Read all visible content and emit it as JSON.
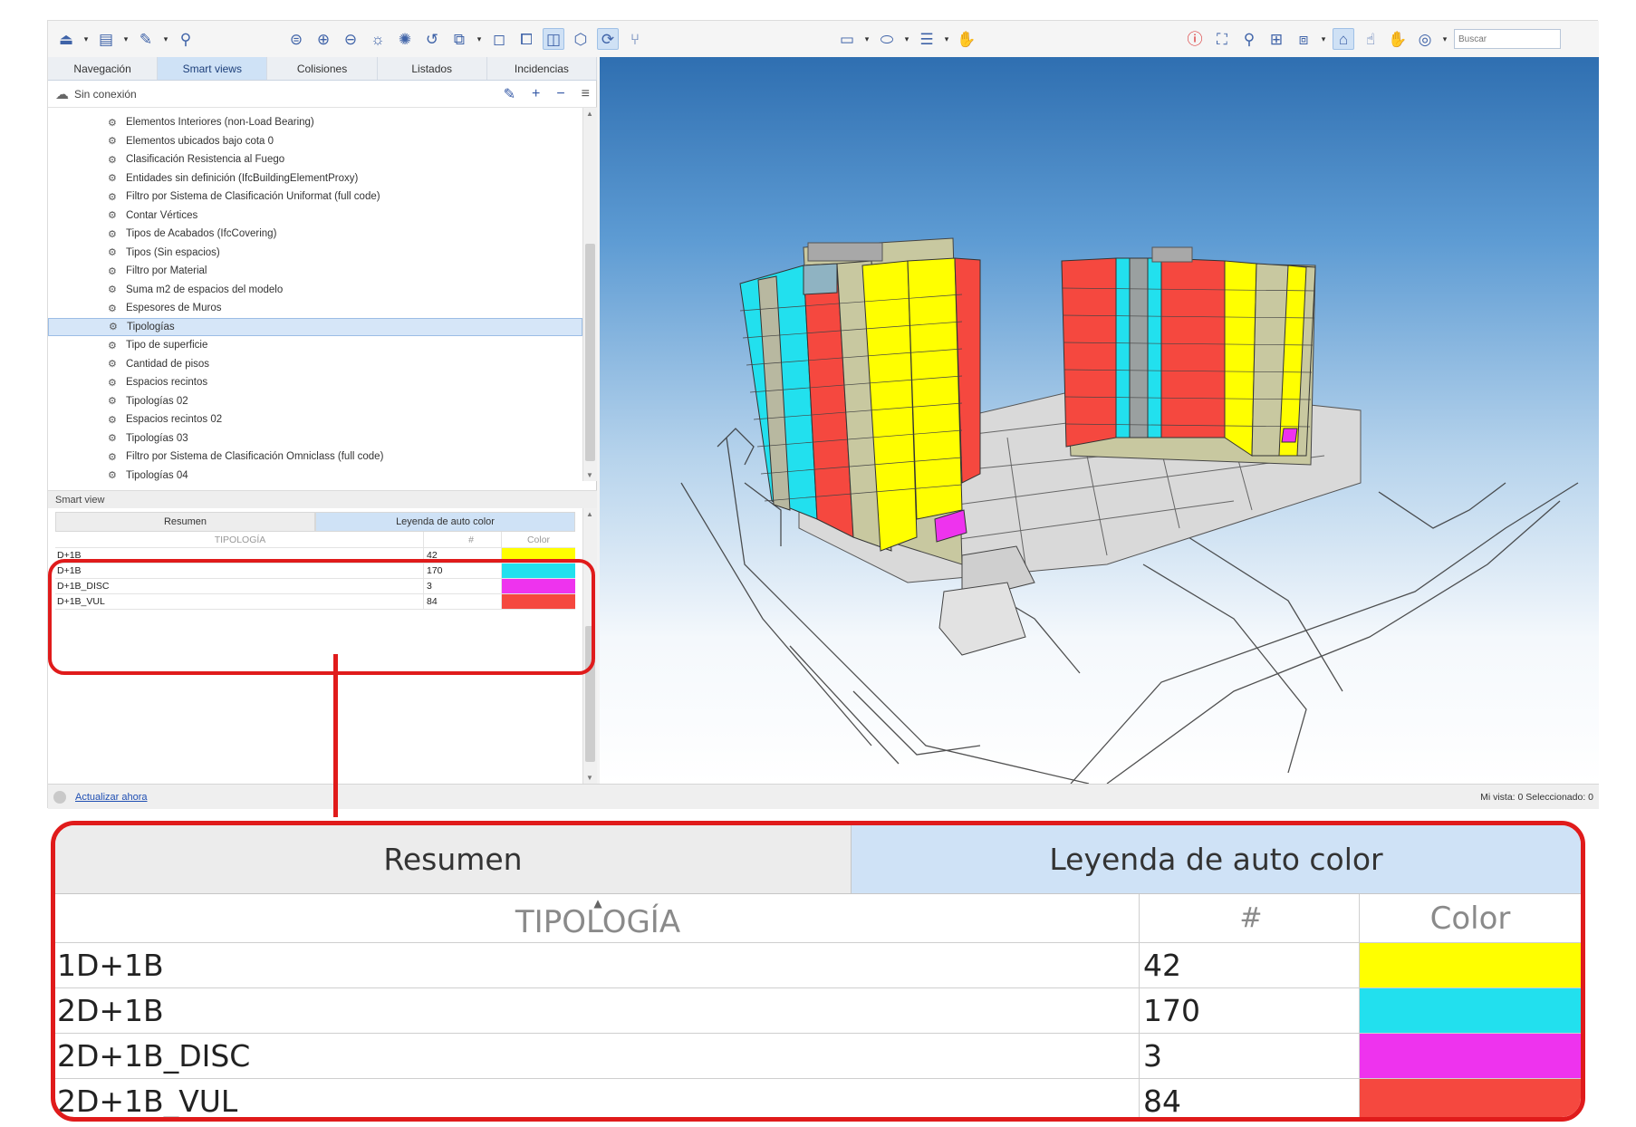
{
  "toolbar": {
    "search_placeholder": "Buscar"
  },
  "main_tabs": [
    "Navegación",
    "Smart views",
    "Colisiones",
    "Listados",
    "Incidencias"
  ],
  "connection": {
    "status": "Sin conexión"
  },
  "tree_items": [
    "Elementos Interiores (non-Load Bearing)",
    "Elementos ubicados bajo cota 0",
    "Clasificación Resistencia al Fuego",
    "Entidades sin definición (IfcBuildingElementProxy)",
    "Filtro por Sistema de Clasificación Uniformat (full code)",
    "Contar Vértices",
    "Tipos de Acabados (IfcCovering)",
    "Tipos (Sin espacios)",
    "Filtro por Material",
    "Suma m2 de espacios del modelo",
    "Espesores de Muros",
    "Tipologías",
    "Tipo de superficie",
    "Cantidad de pisos",
    "Espacios recintos",
    "Tipologías 02",
    "Espacios recintos 02",
    "Tipologías 03",
    "Filtro por Sistema de Clasificación Omniclass (full code)",
    "Tipologías 04"
  ],
  "selected_tree_index": 11,
  "smart_view": {
    "title": "Smart view",
    "tabs": [
      "Resumen",
      "Leyenda de auto color"
    ],
    "columns": [
      "TIPOLOGÍA",
      "#",
      "Color"
    ],
    "rows_small": [
      {
        "name": "D+1B",
        "count": "42",
        "color": "#ffff00"
      },
      {
        "name": "D+1B",
        "count": "170",
        "color": "#22e0ee"
      },
      {
        "name": "D+1B_DISC",
        "count": "3",
        "color": "#ee33ee"
      },
      {
        "name": "D+1B_VUL",
        "count": "84",
        "color": "#f5483f"
      }
    ]
  },
  "status_bar": {
    "update_link": "Actualizar ahora",
    "right_text": "Mi vista: 0  Seleccionado: 0"
  },
  "legend": {
    "tabs": [
      "Resumen",
      "Leyenda de auto color"
    ],
    "columns": [
      "TIPOLOGÍA",
      "#",
      "Color"
    ],
    "rows": [
      {
        "name": "1D+1B",
        "count": "42",
        "color": "#ffff00"
      },
      {
        "name": "2D+1B",
        "count": "170",
        "color": "#22e0ee"
      },
      {
        "name": "2D+1B_DISC",
        "count": "3",
        "color": "#ee33ee"
      },
      {
        "name": "2D+1B_VUL",
        "count": "84",
        "color": "#f5483f"
      }
    ]
  }
}
